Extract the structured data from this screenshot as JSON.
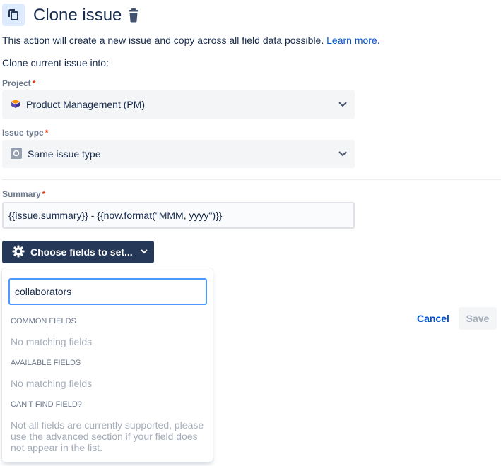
{
  "header": {
    "title": "Clone issue",
    "icon": "copy-icon",
    "delete_icon": "trash-icon"
  },
  "description": {
    "text": "This action will create a new issue and copy across all field data possible.",
    "link": "Learn more."
  },
  "clone_into_label": "Clone current issue into:",
  "project": {
    "label": "Project",
    "required_mark": "*",
    "value": "Product Management (PM)",
    "icon": "project-avatar-icon"
  },
  "issue_type": {
    "label": "Issue type",
    "required_mark": "*",
    "value": "Same issue type",
    "icon": "issue-type-icon"
  },
  "summary": {
    "label": "Summary",
    "required_mark": "*",
    "value": "{{issue.summary}} - {{now.format(\"MMM, yyyy\")}}"
  },
  "choose_fields": {
    "label": "Choose fields to set...",
    "icon": "gear-icon"
  },
  "field_picker": {
    "search_value": "collaborators",
    "common_header": "COMMON FIELDS",
    "common_empty": "No matching fields",
    "available_header": "AVAILABLE FIELDS",
    "available_empty": "No matching fields",
    "cant_find_header": "CAN'T FIND FIELD?",
    "cant_find_help": "Not all fields are currently supported, please use the advanced section if your field does not appear in the list."
  },
  "actions": {
    "cancel": "Cancel",
    "save": "Save"
  },
  "colors": {
    "primary_link": "#0052cc",
    "dark_button": "#253858",
    "required": "#de350b",
    "focus_border": "#4c9aff"
  }
}
